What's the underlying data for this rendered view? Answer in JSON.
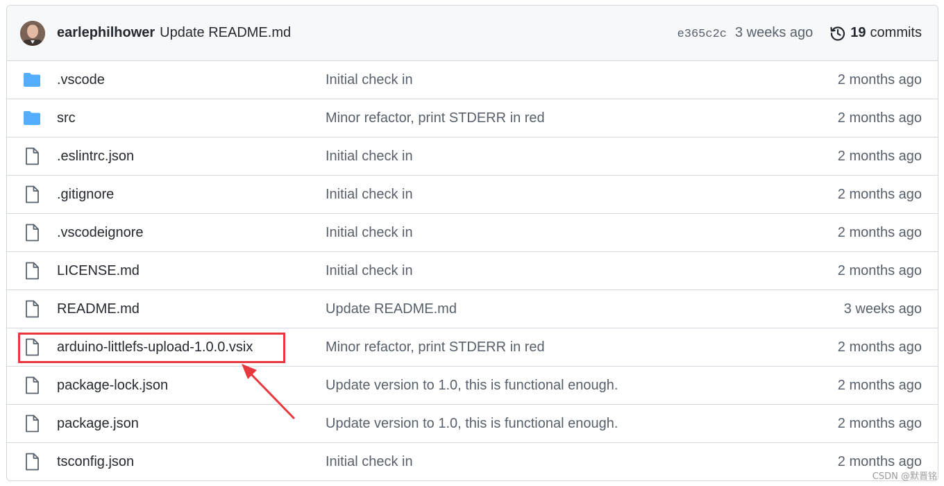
{
  "commit": {
    "author": "earlephilhower",
    "message": "Update README.md",
    "sha": "e365c2c",
    "age": "3 weeks ago",
    "commit_count": "19",
    "commits_label": "commits"
  },
  "files": [
    {
      "name": ".vscode",
      "type": "folder",
      "message": "Initial check in",
      "age": "2 months ago"
    },
    {
      "name": "src",
      "type": "folder",
      "message": "Minor refactor, print STDERR in red",
      "age": "2 months ago"
    },
    {
      "name": ".eslintrc.json",
      "type": "file",
      "message": "Initial check in",
      "age": "2 months ago"
    },
    {
      "name": ".gitignore",
      "type": "file",
      "message": "Initial check in",
      "age": "2 months ago"
    },
    {
      "name": ".vscodeignore",
      "type": "file",
      "message": "Initial check in",
      "age": "2 months ago"
    },
    {
      "name": "LICENSE.md",
      "type": "file",
      "message": "Initial check in",
      "age": "2 months ago"
    },
    {
      "name": "README.md",
      "type": "file",
      "message": "Update README.md",
      "age": "3 weeks ago"
    },
    {
      "name": "arduino-littlefs-upload-1.0.0.vsix",
      "type": "file",
      "message": "Minor refactor, print STDERR in red",
      "age": "2 months ago"
    },
    {
      "name": "package-lock.json",
      "type": "file",
      "message": "Update version to 1.0, this is functional enough.",
      "age": "2 months ago"
    },
    {
      "name": "package.json",
      "type": "file",
      "message": "Update version to 1.0, this is functional enough.",
      "age": "2 months ago"
    },
    {
      "name": "tsconfig.json",
      "type": "file",
      "message": "Initial check in",
      "age": "2 months ago"
    }
  ],
  "icons": {
    "folder": "folder-icon",
    "file": "file-icon",
    "history": "history-icon"
  },
  "colors": {
    "folder": "#54aeff",
    "annotation": "#e8383d",
    "muted": "#57606a"
  },
  "annotation": {
    "highlighted_file": "arduino-littlefs-upload-1.0.0.vsix"
  },
  "watermark": "CSDN @默晋铭"
}
